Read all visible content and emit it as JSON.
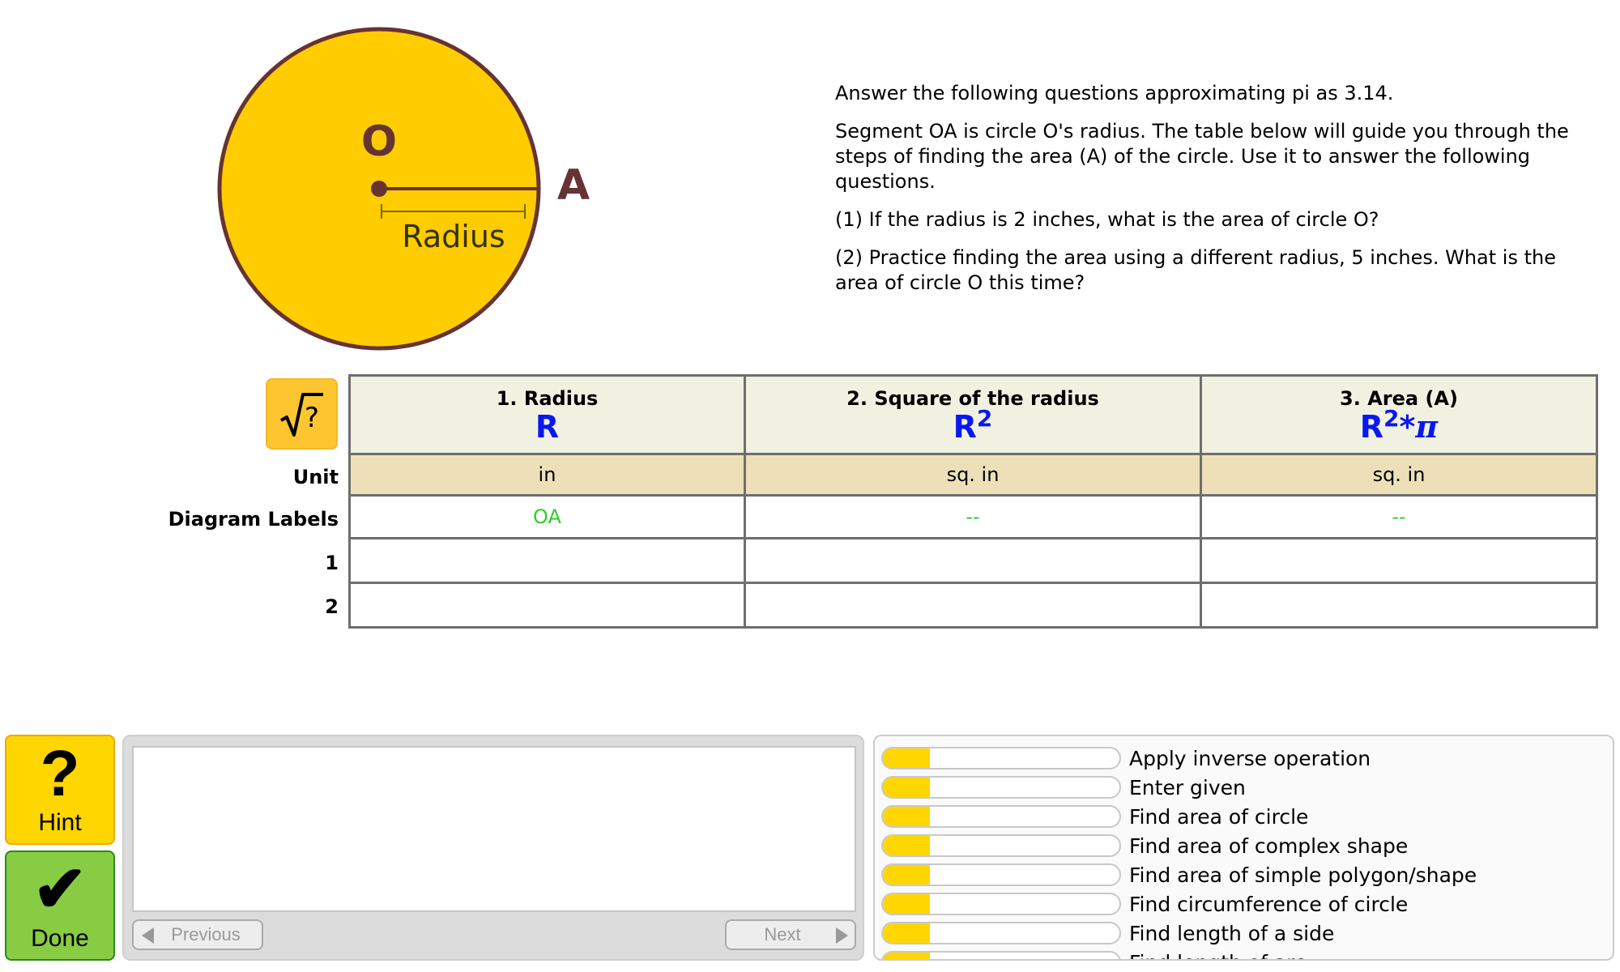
{
  "diagram": {
    "center_label": "O",
    "point_label": "A",
    "segment_label": "Radius",
    "fill_color": "#ffcc00",
    "stroke_color": "#663333"
  },
  "problem": {
    "paragraphs": [
      "Answer the following questions approximating pi as 3.14.",
      "Segment OA is circle O's radius. The table below will guide you through the steps of finding the area (A) of the circle. Use it to answer the following questions.",
      "(1) If the radius is 2 inches, what is the area of circle O?",
      "(2) Practice finding the area using a different radius, 5 inches. What is the area of circle O this time?"
    ]
  },
  "tools": {
    "sqrt_button_icon": "sqrt-question-icon"
  },
  "table": {
    "row_labels": {
      "unit": "Unit",
      "diagram_labels": "Diagram Labels",
      "row1": "1",
      "row2": "2"
    },
    "columns": [
      {
        "title": "1. Radius",
        "formula_base": "R",
        "formula_sup": "",
        "formula_tail": "",
        "unit": "in",
        "diagram_label": "OA"
      },
      {
        "title": "2. Square of the radius",
        "formula_base": "R",
        "formula_sup": "2",
        "formula_tail": "",
        "unit": "sq. in",
        "diagram_label": "--"
      },
      {
        "title": "3. Area (A)",
        "formula_base": "R",
        "formula_sup": "2",
        "formula_tail": "*",
        "formula_pi": "π",
        "unit": "sq. in",
        "diagram_label": "--"
      }
    ],
    "answers": [
      [
        "",
        "",
        ""
      ],
      [
        "",
        "",
        ""
      ]
    ]
  },
  "buttons": {
    "hint_label": "Hint",
    "hint_icon": "question-mark-icon",
    "done_label": "Done",
    "done_icon": "checkmark-icon"
  },
  "feedback": {
    "message": "",
    "previous_label": "Previous",
    "next_label": "Next"
  },
  "skills": {
    "fill_color": "#ffd600",
    "items": [
      {
        "label": "Apply inverse operation",
        "mastery": 0.2
      },
      {
        "label": "Enter given",
        "mastery": 0.2
      },
      {
        "label": "Find area of circle",
        "mastery": 0.2
      },
      {
        "label": "Find area of complex shape",
        "mastery": 0.2
      },
      {
        "label": "Find area of simple polygon/shape",
        "mastery": 0.2
      },
      {
        "label": "Find circumference of circle",
        "mastery": 0.2
      },
      {
        "label": "Find length of a side",
        "mastery": 0.2
      },
      {
        "label": "Find length of arc",
        "mastery": 0.2
      }
    ]
  }
}
